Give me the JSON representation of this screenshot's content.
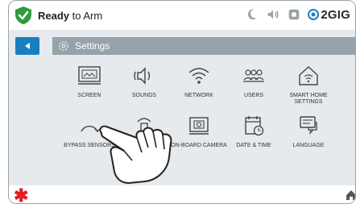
{
  "status": {
    "state_bold": "Ready",
    "state_rest": " to Arm",
    "brand": "2GIG",
    "icons": [
      "moon-icon",
      "speaker-icon",
      "wifi-box-icon",
      "brand-logo-icon"
    ]
  },
  "header": {
    "title": "Settings",
    "back_icon": "back-arrow-icon",
    "title_icon": "gear-icon"
  },
  "tiles": [
    {
      "label": "SCREEN",
      "icon": "screen-icon"
    },
    {
      "label": "SOUNDS",
      "icon": "speaker-icon"
    },
    {
      "label": "NETWORK",
      "icon": "wifi-icon"
    },
    {
      "label": "USERS",
      "icon": "users-icon"
    },
    {
      "label": "SMART HOME SETTINGS",
      "icon": "smart-home-icon"
    },
    {
      "label": "BYPASS SENSORS",
      "icon": "bypass-icon"
    },
    {
      "label": "",
      "icon": "sensor-icon"
    },
    {
      "label": "ON-BOARD CAMERA",
      "icon": "camera-icon"
    },
    {
      "label": "DATE & TIME",
      "icon": "calendar-clock-icon"
    },
    {
      "label": "LANGUAGE",
      "icon": "chat-icon"
    }
  ],
  "footer": {
    "emergency_icon": "asterisk-icon",
    "home_icon": "home-icon"
  },
  "colors": {
    "accent": "#1a7fc1",
    "header_bar": "#97a3aa",
    "content_bg": "#e6eaec",
    "ready_green": "#2e9b3e",
    "emergency_red": "#e02020"
  }
}
